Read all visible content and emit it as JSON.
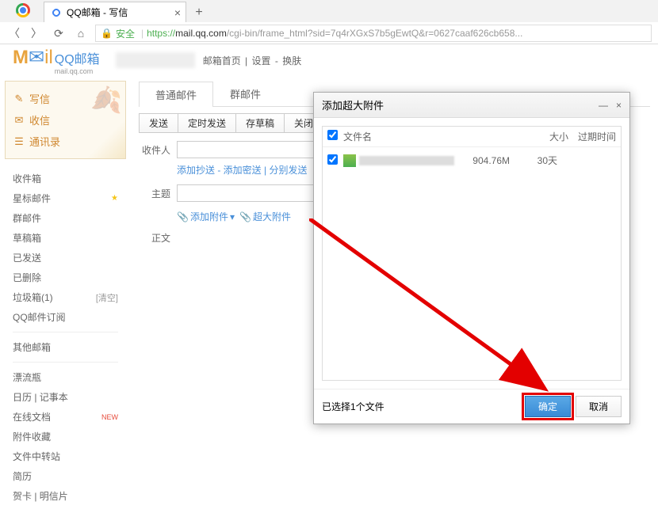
{
  "browser": {
    "tab_title": "QQ邮箱 - 写信",
    "url_secure": "安全",
    "url_protocol": "https://",
    "url_domain": "mail.qq.com",
    "url_path": "/cgi-bin/frame_html?sid=7q4rXGxS7b5gEwtQ&r=0627caaf626cb658..."
  },
  "header": {
    "logo_brand": "QQ邮箱",
    "logo_sub": "mail.qq.com",
    "links": [
      "邮箱首页",
      "设置",
      "换肤"
    ]
  },
  "sidebar": {
    "primary": [
      {
        "icon": "✎",
        "label": "写信"
      },
      {
        "icon": "✉",
        "label": "收信"
      },
      {
        "icon": "☰",
        "label": "通讯录"
      }
    ],
    "folders": [
      {
        "label": "收件箱"
      },
      {
        "label": "星标邮件",
        "star": true
      },
      {
        "label": "群邮件"
      },
      {
        "label": "草稿箱"
      },
      {
        "label": "已发送"
      },
      {
        "label": "已删除"
      },
      {
        "label": "垃圾箱(1)",
        "clear": "[清空]"
      },
      {
        "label": "QQ邮件订阅"
      }
    ],
    "other_header": "其他邮箱",
    "tools": [
      {
        "label": "漂流瓶"
      },
      {
        "label": "日历 | 记事本"
      },
      {
        "label": "在线文档",
        "new": "NEW"
      },
      {
        "label": "附件收藏"
      },
      {
        "label": "文件中转站"
      },
      {
        "label": "简历"
      },
      {
        "label": "贺卡 | 明信片"
      }
    ]
  },
  "compose": {
    "tabs": [
      "普通邮件",
      "群邮件"
    ],
    "actions": [
      "发送",
      "定时发送",
      "存草稿",
      "关闭"
    ],
    "recipient_label": "收件人",
    "recipient_sublinks": "添加抄送 - 添加密送 | 分别发送",
    "subject_label": "主题",
    "attach_label": "添加附件",
    "large_attach_label": "超大附件",
    "body_label": "正文"
  },
  "dialog": {
    "title": "添加超大附件",
    "columns": {
      "name": "文件名",
      "size": "大小",
      "expire": "过期时间"
    },
    "file": {
      "size": "904.76M",
      "expire": "30天"
    },
    "selected_text": "已选择1个文件",
    "ok": "确定",
    "cancel": "取消"
  }
}
